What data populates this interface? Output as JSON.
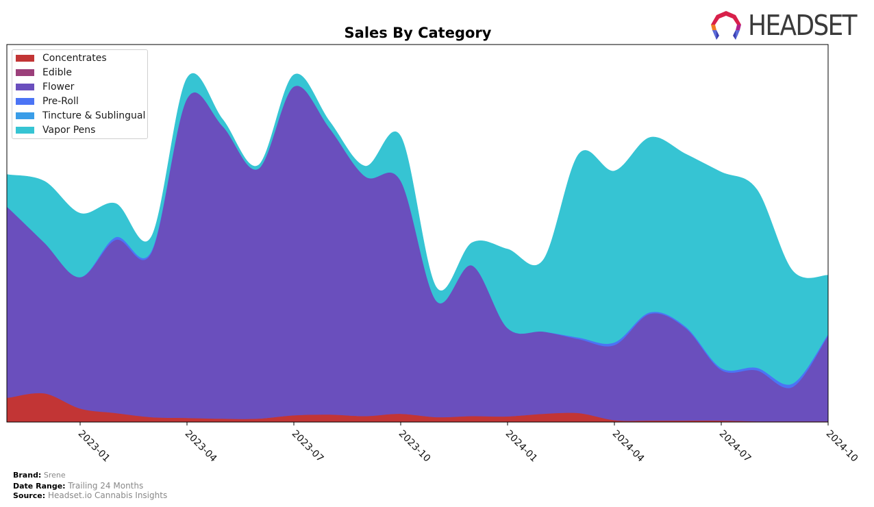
{
  "header": {
    "logo_text": "HEADSET"
  },
  "footer": {
    "brand_label": "Brand:",
    "brand_value": "Srene",
    "date_range_label": "Date Range:",
    "date_range_value": "Trailing 24 Months",
    "source_label": "Source:",
    "source_value": "Headset.io Cannabis Insights"
  },
  "chart_data": {
    "type": "area",
    "stacked": true,
    "smooth": true,
    "title": "Sales By Category",
    "xlabel": "",
    "ylabel": "",
    "ylim": [
      0,
      100
    ],
    "y_axis_visible": false,
    "grid": false,
    "legend_position": "top-left",
    "x_tick_labels": [
      "2023-01",
      "2023-04",
      "2023-07",
      "2023-10",
      "2024-01",
      "2024-04",
      "2024-07",
      "2024-10"
    ],
    "x": [
      "2022-11",
      "2022-12",
      "2023-01",
      "2023-02",
      "2023-03",
      "2023-04",
      "2023-05",
      "2023-06",
      "2023-07",
      "2023-08",
      "2023-09",
      "2023-10",
      "2023-11",
      "2023-12",
      "2024-01",
      "2024-02",
      "2024-03",
      "2024-04",
      "2024-05",
      "2024-06",
      "2024-07",
      "2024-08",
      "2024-09",
      "2024-10"
    ],
    "series": [
      {
        "name": "Concentrates",
        "color": "#c23535",
        "values": [
          6.5,
          7.6,
          3.6,
          2.4,
          1.3,
          1.1,
          0.9,
          0.9,
          1.8,
          2.0,
          1.6,
          2.2,
          1.3,
          1.6,
          1.5,
          2.2,
          2.4,
          0.5,
          0.4,
          0.4,
          0.4,
          0.2,
          0.2,
          0.2
        ]
      },
      {
        "name": "Edible",
        "color": "#9b3f7a",
        "values": [
          0,
          0,
          0,
          0,
          0,
          0,
          0,
          0,
          0,
          0,
          0,
          0,
          0,
          0,
          0,
          0,
          0,
          0,
          0,
          0,
          0,
          0,
          0,
          0
        ]
      },
      {
        "name": "Flower",
        "color": "#6a4fbd",
        "values": [
          50.1,
          39.9,
          34.8,
          45.9,
          43.6,
          84.6,
          77.5,
          66.2,
          87.1,
          75.9,
          63.5,
          61.7,
          30.8,
          39.9,
          23.4,
          21.8,
          19.6,
          19.9,
          28.3,
          24.5,
          13.4,
          13.5,
          9.1,
          22.7
        ]
      },
      {
        "name": "Pre-Roll",
        "color": "#4b74f5",
        "values": [
          0,
          0,
          0,
          0.7,
          0.4,
          0,
          0,
          0,
          0,
          0,
          0,
          0,
          0,
          0,
          0,
          0,
          0.4,
          0.7,
          0.4,
          0.4,
          0.5,
          0.7,
          0.9,
          0.4
        ]
      },
      {
        "name": "Tincture & Sublingual",
        "color": "#3a9de8",
        "values": [
          0,
          0,
          0,
          0,
          0,
          0,
          0,
          0,
          0,
          0,
          0,
          0,
          0,
          0,
          0,
          0,
          0,
          0,
          0,
          0,
          0,
          0,
          0,
          0
        ]
      },
      {
        "name": "Vapor Pens",
        "color": "#36c4d3",
        "values": [
          8.9,
          16.3,
          16.9,
          8.9,
          3.8,
          5.4,
          1.8,
          0.9,
          3.1,
          1.8,
          2.7,
          11.8,
          3.6,
          6.0,
          20.9,
          18.9,
          48.6,
          45.4,
          46.3,
          45.7,
          51.9,
          47.2,
          29.9,
          15.6
        ]
      }
    ]
  }
}
